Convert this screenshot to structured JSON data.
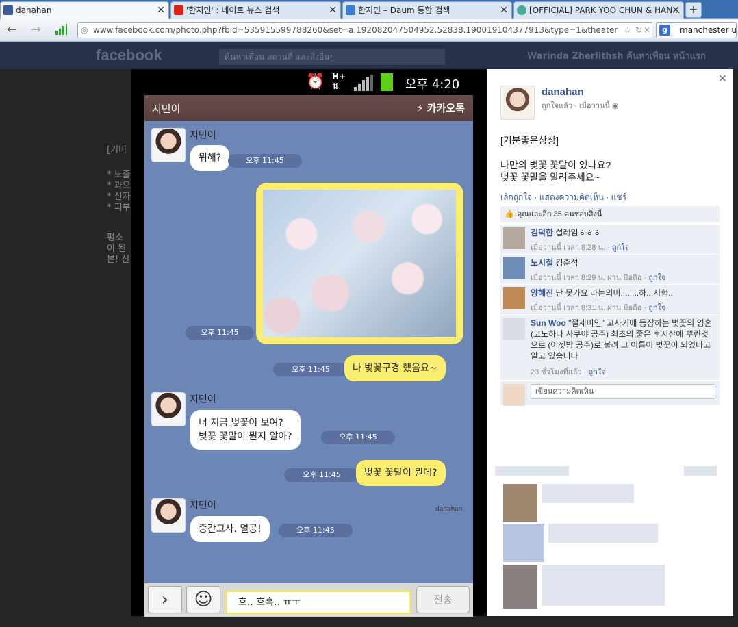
{
  "browser": {
    "tabs": [
      {
        "label": "danahan",
        "color": "#3b5998"
      },
      {
        "label": "'한지민' : 네이트 뉴스 검색",
        "color": "#d21"
      },
      {
        "label": "한지민 – Daum 통합 검색",
        "color": "#3a7bd5"
      },
      {
        "label": "[OFFICIAL] PARK YOO CHUN & HAN...",
        "color": "#4a9"
      }
    ],
    "new_tab": "+",
    "url": "www.facebook.com/photo.php?fbid=535915599788260&set=a.192082047504952.52838.190019104377913&type=1&theater",
    "search_value": "manchester uni"
  },
  "fb": {
    "logo": "facebook",
    "search_placeholder": "ค้นหาเพื่อน สถานที่ และสิ่งอื่นๆ",
    "user": "Warinda Zherlithsh  ค้นหาเพื่อน  หน้าแรก",
    "left_snippets": [
      "[기미",
      "* 노출",
      "* 과으",
      "* 신자",
      "* 피부",
      "평소",
      "이 된",
      "본! 신"
    ]
  },
  "phone": {
    "status_time": "오후 4:20",
    "chat_name": "지민이",
    "app_name": "카카오톡",
    "messages": [
      {
        "sender": "지민이",
        "text": "뭐해?",
        "time": "오후 11:45"
      },
      {
        "time": "오후 11:45"
      },
      {
        "text": "나 벚꽃구경 했음요~",
        "time": "오후 11:45"
      },
      {
        "sender": "지민이",
        "line1": "너 지금 벚꽃이 보여?",
        "line2": "벚꽃 꽃말이 뭔지 알아?",
        "time": "오후 11:45"
      },
      {
        "text": "벚꽃 꽃말이 뭔데?",
        "time": "오후 11:45"
      },
      {
        "sender": "지민이",
        "text": "중간고사. 열공!",
        "time": "오후 11:45"
      }
    ],
    "input_text": "흐.. 흐흑.. ㅠㅜ",
    "send_label": "전송",
    "watermark": "danahan"
  },
  "panel": {
    "page_name": "danahan",
    "meta": "ถูกใจแล้ว · เมื่อวานนี้",
    "post_line1": "[기분좋은상상]",
    "post_line2": "나만의 벚꽃 꽃말이 있나요?",
    "post_line3": "벚꽃 꽃말을 알려주세요~",
    "actions": "เลิกถูกใจ · แสดงความคิดเห็น · แชร์",
    "likes": "คุณและอีก 35 คนชอบสิ่งนี้",
    "comments": [
      {
        "name": "김덕한",
        "text": "설레임ㅎㅎㅎ",
        "meta": "เมื่อวานนี้ เวลา 8:28 น. ·",
        "like": "ถูกใจ"
      },
      {
        "name": "노시철",
        "text": "김준석",
        "meta": "เมื่อวานนี้ เวลา 8:29 น. ผ่าน มือถือ ·",
        "like": "ถูกใจ"
      },
      {
        "name": "양혜진",
        "text": "난 못가요 라는의미........하...시험..",
        "meta": "เมื่อวานนี้ เวลา 8:31 น. ผ่าน มือถือ ·",
        "like": "ถูกใจ"
      },
      {
        "name": "Sun Woo",
        "text": "\"절세미인\" 고사기에 등장하는 벚꽃의 영혼(코노하나 사쿠야 공주) 최초의 좋은 후지산에 뿌린것으로 (어젯밤 공주)로 불려 그 이름이 벚꽃이 되었다고 알고 있습니다",
        "meta": "23 ชั่วโมงที่แล้ว ·",
        "like": "ถูกใจ"
      }
    ],
    "comment_placeholder": "เขียนความคิดเห็น"
  }
}
